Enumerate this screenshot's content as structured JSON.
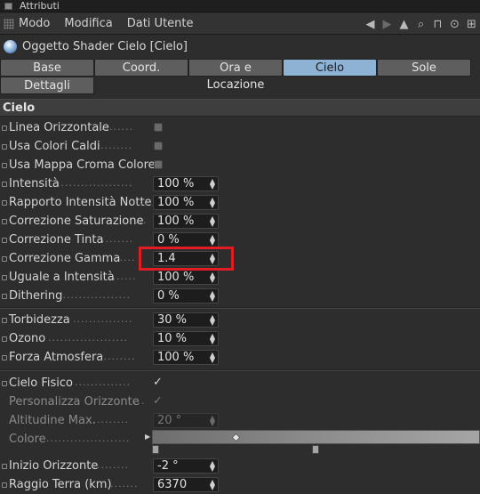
{
  "window": {
    "title": "Attributi"
  },
  "menu": {
    "items": [
      "Modo",
      "Modifica",
      "Dati Utente"
    ],
    "tools": [
      "arrow-left-icon",
      "arrow-right-icon",
      "arrow-up-icon",
      "search-icon",
      "lock-icon",
      "target-icon",
      "add-icon"
    ]
  },
  "object": {
    "title": "Oggetto Shader Cielo [Cielo]",
    "icon": "sky-shader-icon"
  },
  "tabs": {
    "row1": [
      "Base",
      "Coord.",
      "Ora e Locazione",
      "Cielo",
      "Sole"
    ],
    "row2": [
      "Dettagli"
    ],
    "active": "Cielo"
  },
  "section": {
    "title": "Cielo"
  },
  "params": {
    "linea_orizzontale": {
      "label": "Linea Orizzontale",
      "checked": false
    },
    "usa_colori_caldi": {
      "label": "Usa Colori Caldi",
      "checked": false
    },
    "usa_mappa_croma": {
      "label": "Usa Mappa Croma Colore",
      "checked": false
    },
    "intensita": {
      "label": "Intensità",
      "value": "100 %"
    },
    "rapporto": {
      "label": "Rapporto Intensità Notte",
      "value": "100 %"
    },
    "corr_saturazione": {
      "label": "Correzione Saturazione",
      "value": "100 %"
    },
    "corr_tinta": {
      "label": "Correzione Tinta",
      "value": "0 %"
    },
    "corr_gamma": {
      "label": "Correzione Gamma",
      "value": "1.4"
    },
    "uguale_intensita": {
      "label": "Uguale a Intensità",
      "value": "100 %"
    },
    "dithering": {
      "label": "Dithering",
      "value": "0 %"
    },
    "torbidezza": {
      "label": "Torbidezza",
      "value": "30 %"
    },
    "ozono": {
      "label": "Ozono",
      "value": "10 %"
    },
    "forza_atmosfera": {
      "label": "Forza Atmosfera",
      "value": "100 %"
    },
    "cielo_fisico": {
      "label": "Cielo Fisico",
      "checked": true
    },
    "personalizza": {
      "label": "Personalizza Orizzonte",
      "checked": true
    },
    "altitudine": {
      "label": "Altitudine Max.",
      "value": "20 °"
    },
    "colore": {
      "label": "Colore"
    },
    "inizio_orizzonte": {
      "label": "Inizio Orizzonte",
      "value": "-2 °"
    },
    "raggio_terra": {
      "label": "Raggio Terra (km)",
      "value": "6370"
    }
  },
  "colors": {
    "accent_tab": "#8eb2d4",
    "highlight": "#e11c22"
  }
}
